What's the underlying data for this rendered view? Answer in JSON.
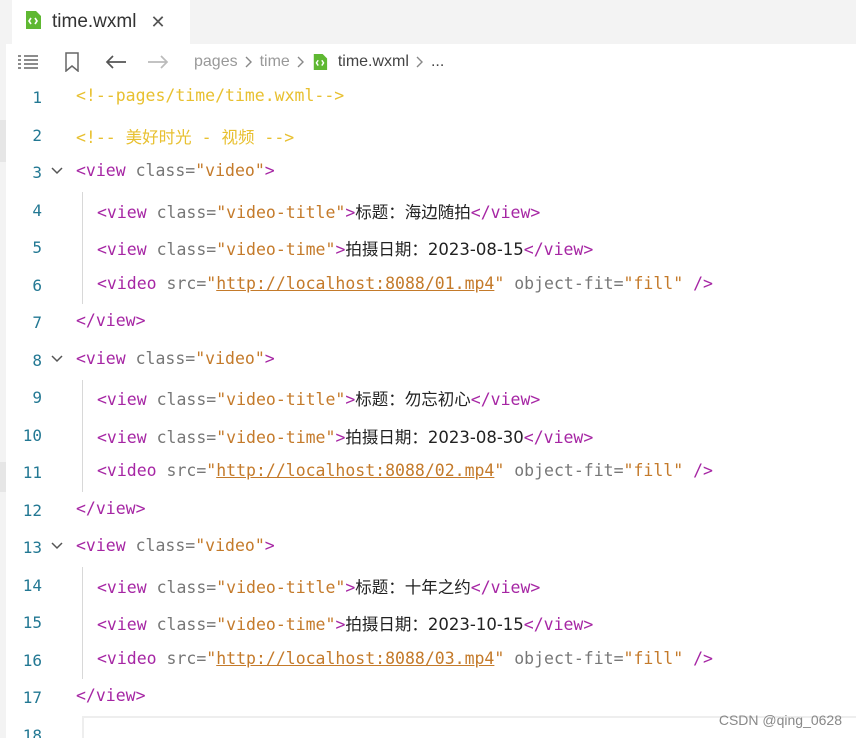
{
  "tab": {
    "title": "time.wxml",
    "close": "✕",
    "icon": "wxml-file-icon"
  },
  "toolbar": {
    "icons": [
      "list-icon",
      "bookmark-icon",
      "back-arrow-icon",
      "forward-arrow-icon"
    ],
    "breadcrumb": [
      "pages",
      "time",
      "time.wxml",
      "..."
    ]
  },
  "lines": [
    {
      "n": "1",
      "fold": false,
      "indent": false,
      "tokens": [
        [
          "c-comment",
          "<!--pages/time/time.wxml-->"
        ]
      ]
    },
    {
      "n": "2",
      "fold": false,
      "indent": false,
      "tokens": [
        [
          "c-comment",
          "<!-- "
        ],
        [
          "c-comment-cn",
          "美好时光 - 视频"
        ],
        [
          "c-comment",
          " -->"
        ]
      ]
    },
    {
      "n": "3",
      "fold": true,
      "indent": false,
      "tokens": [
        [
          "c-tag",
          "<view"
        ],
        [
          "c-attr",
          " class="
        ],
        [
          "c-val",
          "\"video\""
        ],
        [
          "c-tag",
          ">"
        ]
      ]
    },
    {
      "n": "4",
      "fold": false,
      "indent": true,
      "tokens": [
        [
          "c-tag",
          "<view"
        ],
        [
          "c-attr",
          " class="
        ],
        [
          "c-val",
          "\"video-title\""
        ],
        [
          "c-tag",
          ">"
        ],
        [
          "c-text",
          "标题：海边随拍"
        ],
        [
          "c-tag",
          "</view>"
        ]
      ]
    },
    {
      "n": "5",
      "fold": false,
      "indent": true,
      "tokens": [
        [
          "c-tag",
          "<view"
        ],
        [
          "c-attr",
          " class="
        ],
        [
          "c-val",
          "\"video-time\""
        ],
        [
          "c-tag",
          ">"
        ],
        [
          "c-text",
          "拍摄日期：2023-08-15"
        ],
        [
          "c-tag",
          "</view>"
        ]
      ]
    },
    {
      "n": "6",
      "fold": false,
      "indent": true,
      "tokens": [
        [
          "c-tag",
          "<video"
        ],
        [
          "c-attr",
          " src="
        ],
        [
          "c-val",
          "\""
        ],
        [
          "c-link",
          "http://localhost:8088/01.mp4"
        ],
        [
          "c-val",
          "\""
        ],
        [
          "c-attr",
          " object-fit="
        ],
        [
          "c-val",
          "\"fill\""
        ],
        [
          "c-tag",
          " />"
        ]
      ]
    },
    {
      "n": "7",
      "fold": false,
      "indent": false,
      "tokens": [
        [
          "c-tag",
          "</view>"
        ]
      ]
    },
    {
      "n": "8",
      "fold": true,
      "indent": false,
      "tokens": [
        [
          "c-tag",
          "<view"
        ],
        [
          "c-attr",
          " class="
        ],
        [
          "c-val",
          "\"video\""
        ],
        [
          "c-tag",
          ">"
        ]
      ]
    },
    {
      "n": "9",
      "fold": false,
      "indent": true,
      "tokens": [
        [
          "c-tag",
          "<view"
        ],
        [
          "c-attr",
          " class="
        ],
        [
          "c-val",
          "\"video-title\""
        ],
        [
          "c-tag",
          ">"
        ],
        [
          "c-text",
          "标题：勿忘初心"
        ],
        [
          "c-tag",
          "</view>"
        ]
      ]
    },
    {
      "n": "10",
      "fold": false,
      "indent": true,
      "tokens": [
        [
          "c-tag",
          "<view"
        ],
        [
          "c-attr",
          " class="
        ],
        [
          "c-val",
          "\"video-time\""
        ],
        [
          "c-tag",
          ">"
        ],
        [
          "c-text",
          "拍摄日期：2023-08-30"
        ],
        [
          "c-tag",
          "</view>"
        ]
      ]
    },
    {
      "n": "11",
      "fold": false,
      "indent": true,
      "tokens": [
        [
          "c-tag",
          "<video"
        ],
        [
          "c-attr",
          " src="
        ],
        [
          "c-val",
          "\""
        ],
        [
          "c-link",
          "http://localhost:8088/02.mp4"
        ],
        [
          "c-val",
          "\""
        ],
        [
          "c-attr",
          " object-fit="
        ],
        [
          "c-val",
          "\"fill\""
        ],
        [
          "c-tag",
          " />"
        ]
      ]
    },
    {
      "n": "12",
      "fold": false,
      "indent": false,
      "tokens": [
        [
          "c-tag",
          "</view>"
        ]
      ]
    },
    {
      "n": "13",
      "fold": true,
      "indent": false,
      "tokens": [
        [
          "c-tag",
          "<view"
        ],
        [
          "c-attr",
          " class="
        ],
        [
          "c-val",
          "\"video\""
        ],
        [
          "c-tag",
          ">"
        ]
      ]
    },
    {
      "n": "14",
      "fold": false,
      "indent": true,
      "tokens": [
        [
          "c-tag",
          "<view"
        ],
        [
          "c-attr",
          " class="
        ],
        [
          "c-val",
          "\"video-title\""
        ],
        [
          "c-tag",
          ">"
        ],
        [
          "c-text",
          "标题：十年之约"
        ],
        [
          "c-tag",
          "</view>"
        ]
      ]
    },
    {
      "n": "15",
      "fold": false,
      "indent": true,
      "tokens": [
        [
          "c-tag",
          "<view"
        ],
        [
          "c-attr",
          " class="
        ],
        [
          "c-val",
          "\"video-time\""
        ],
        [
          "c-tag",
          ">"
        ],
        [
          "c-text",
          "拍摄日期：2023-10-15"
        ],
        [
          "c-tag",
          "</view>"
        ]
      ]
    },
    {
      "n": "16",
      "fold": false,
      "indent": true,
      "tokens": [
        [
          "c-tag",
          "<video"
        ],
        [
          "c-attr",
          " src="
        ],
        [
          "c-val",
          "\""
        ],
        [
          "c-link",
          "http://localhost:8088/03.mp4"
        ],
        [
          "c-val",
          "\""
        ],
        [
          "c-attr",
          " object-fit="
        ],
        [
          "c-val",
          "\"fill\""
        ],
        [
          "c-tag",
          " />"
        ]
      ]
    },
    {
      "n": "17",
      "fold": false,
      "indent": false,
      "tokens": [
        [
          "c-tag",
          "</view>"
        ]
      ]
    },
    {
      "n": "18",
      "fold": false,
      "indent": false,
      "tokens": []
    }
  ],
  "watermark": "CSDN @qing_0628",
  "colors": {
    "tag": "#a626a4",
    "value": "#c47a2a",
    "comment": "#e8c030",
    "line_number": "#237893",
    "file_icon": "#5fb832"
  }
}
